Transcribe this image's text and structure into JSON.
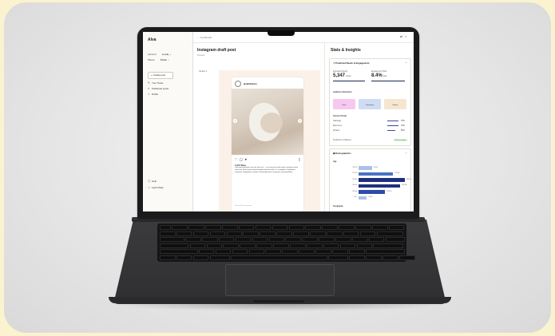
{
  "app": {
    "logo": "Alva",
    "sidebar": {
      "account_label": "Account",
      "account_value": "Loudly",
      "platform_label": "Planet",
      "platform_value": "Twitter",
      "create_button": "Create post",
      "nav": [
        {
          "label": "Your Posts",
          "icon": "edit-icon"
        },
        {
          "label": "Published posts",
          "icon": "list-icon"
        },
        {
          "label": "Drafts",
          "icon": "draft-icon"
        }
      ],
      "footer": [
        {
          "label": "Help",
          "icon": "help-icon"
        },
        {
          "label": "Light Mode",
          "icon": "sun-icon"
        }
      ]
    },
    "topbar": {
      "breadcrumb": "Tips/Drafts"
    },
    "main": {
      "title": "Instagram draft post",
      "subtitle": "Preview",
      "section": "Variant 1",
      "post": {
        "handle": "alvaltdtokios",
        "likes": "1,047 likes",
        "caption": "cherished moments with our little one — the cozy knit outfit keeps everyone warm and snug. Share your favorite family moments with us! #cozyvibes #familytime #knitwear #babystyle #comfort #loveandwarmth #newmom #weekendvibes",
        "comments": "View all 24 comments"
      }
    },
    "insights": {
      "title": "Stats & Insights",
      "engagement_card": {
        "title": "Predicted Reach & Engagement",
        "reach_label": "Estimated Reach",
        "reach_value": "5,347",
        "reach_unit": "views",
        "rate_label": "Engagement Rate",
        "rate_value": "8.4%",
        "rate_unit": "rate",
        "audience_label": "Audience interaction",
        "tiles": [
          {
            "label": "Likes",
            "color": "#f6c8f0"
          },
          {
            "label": "Comments",
            "color": "#cfdcf4"
          },
          {
            "label": "Shares",
            "color": "#f7e6cf"
          }
        ],
        "trends_label": "Current Trends",
        "trends": [
          {
            "label": "Hashtags",
            "value": "75%"
          },
          {
            "label": "Best times",
            "value": "75%"
          },
          {
            "label": "Stickers",
            "value": "50%"
          }
        ],
        "confidence_label": "Prediction confidence",
        "confidence_value": "87% accurate"
      },
      "demographics_card": {
        "title": "Demographics",
        "age_label": "Age",
        "bars": [
          {
            "label": "18-24",
            "value": "8.2%",
            "pct": 8.2,
            "color": "#a9c1e6"
          },
          {
            "label": "25-34",
            "value": "21.0%",
            "pct": 21.0,
            "color": "#4a74c4"
          },
          {
            "label": "35-44",
            "value": "28.1%",
            "pct": 28.1,
            "color": "#1f2f80"
          },
          {
            "label": "45-54",
            "value": "25.3%",
            "pct": 25.3,
            "color": "#1f2f80"
          },
          {
            "label": "55-64",
            "value": "16.1%",
            "pct": 16.1,
            "color": "#2d4ba8"
          },
          {
            "label": "65+",
            "value": "5.0%",
            "pct": 5.0,
            "color": "#a9c1e6"
          }
        ],
        "gender_label": "Geography"
      }
    }
  }
}
